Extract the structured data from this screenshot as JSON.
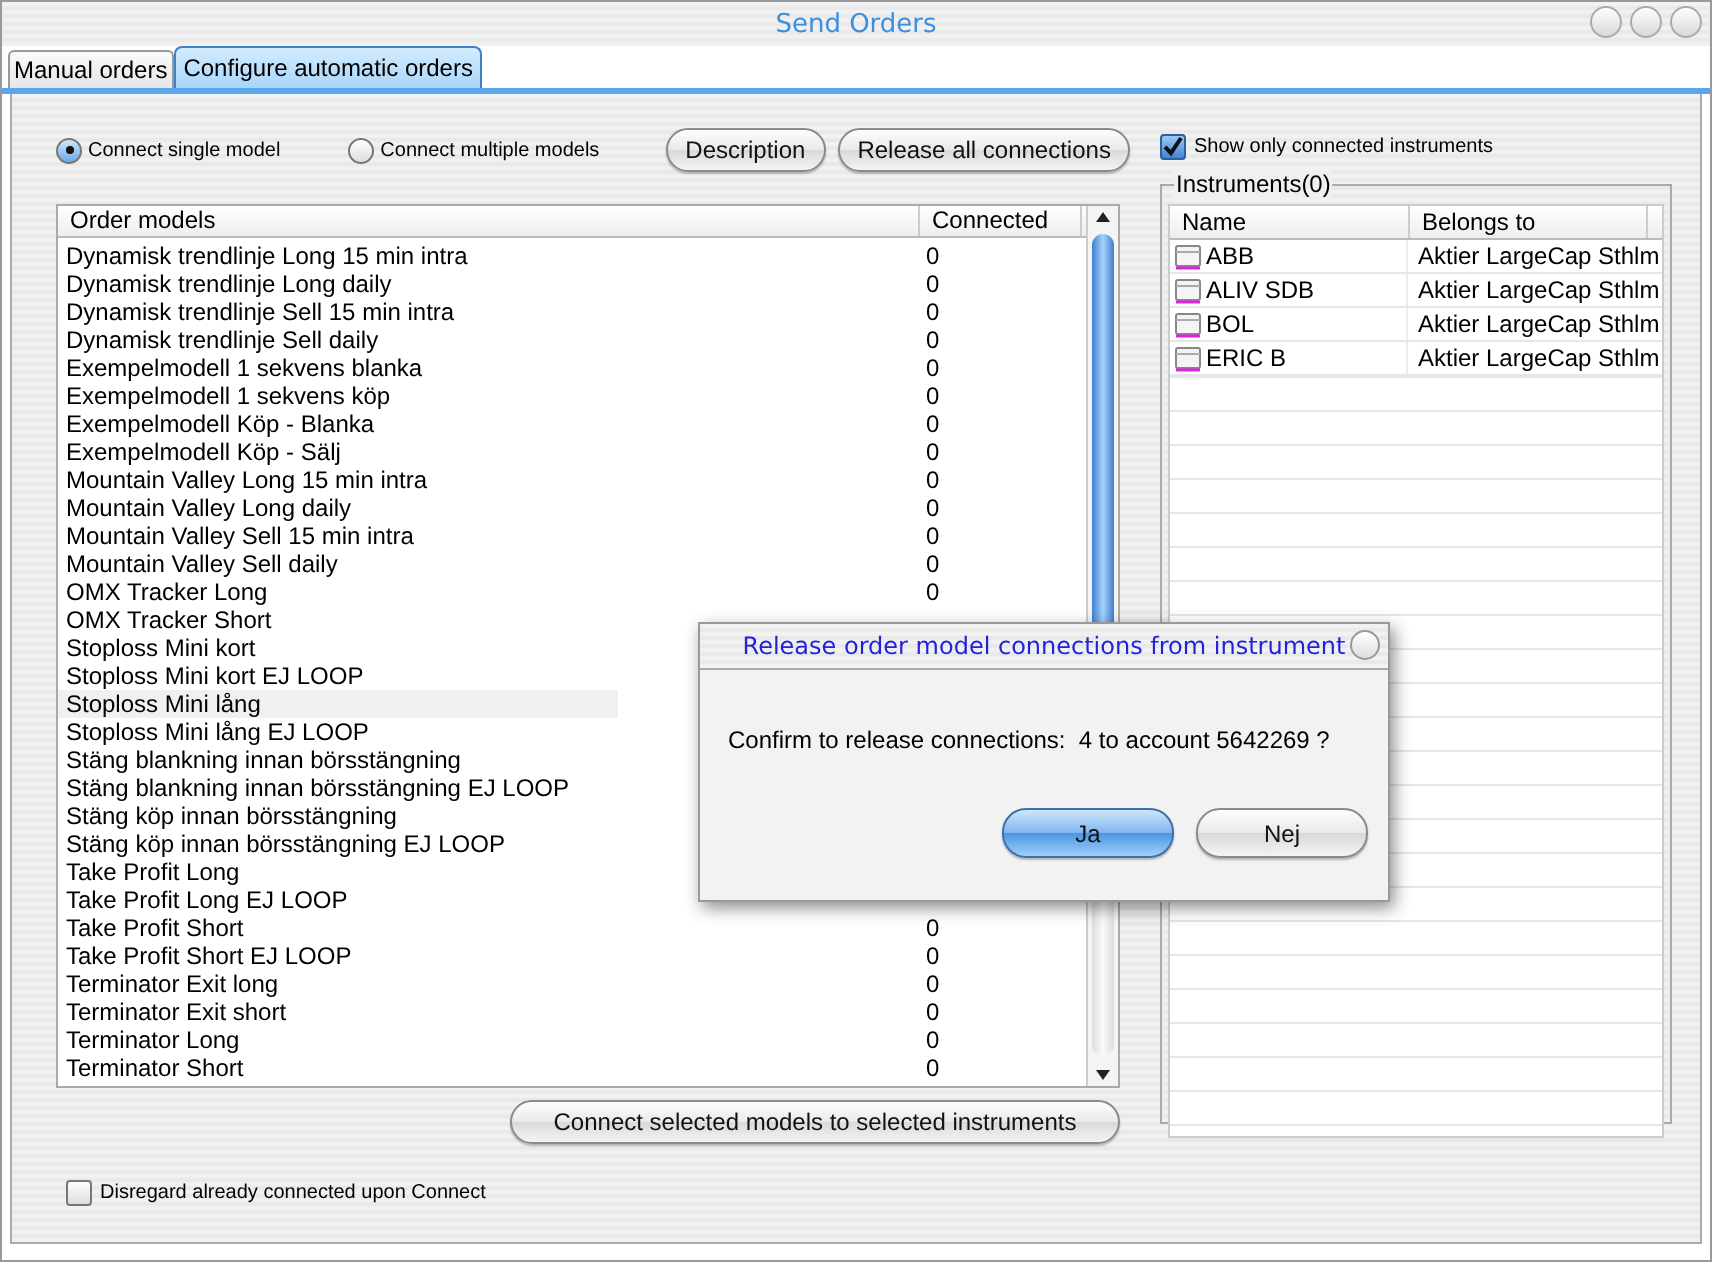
{
  "window": {
    "title": "Send Orders"
  },
  "tabs": [
    {
      "label": "Manual orders",
      "selected": false
    },
    {
      "label": "Configure automatic orders",
      "selected": true
    }
  ],
  "connect_mode": [
    {
      "label": "Connect single model",
      "selected": true
    },
    {
      "label": "Connect multiple models",
      "selected": false
    }
  ],
  "buttons": [
    "Description",
    "Release all connections"
  ],
  "show_only_connected": {
    "label": "Show only connected instruments",
    "checked": true
  },
  "order_models": {
    "columns": [
      "Order models",
      "Connected"
    ],
    "rows": [
      {
        "name": "Dynamisk trendlinje Long 15 min intra",
        "connected": "0",
        "selected": false
      },
      {
        "name": "Dynamisk trendlinje Long daily",
        "connected": "0",
        "selected": false
      },
      {
        "name": "Dynamisk trendlinje Sell 15 min intra",
        "connected": "0",
        "selected": false
      },
      {
        "name": "Dynamisk trendlinje Sell daily",
        "connected": "0",
        "selected": false
      },
      {
        "name": "Exempelmodell 1 sekvens blanka",
        "connected": "0",
        "selected": false
      },
      {
        "name": "Exempelmodell 1 sekvens köp",
        "connected": "0",
        "selected": false
      },
      {
        "name": "Exempelmodell Köp - Blanka",
        "connected": "0",
        "selected": false
      },
      {
        "name": "Exempelmodell Köp - Sälj",
        "connected": "0",
        "selected": false
      },
      {
        "name": "Mountain Valley Long 15 min intra",
        "connected": "0",
        "selected": false
      },
      {
        "name": "Mountain Valley Long daily",
        "connected": "0",
        "selected": false
      },
      {
        "name": "Mountain Valley Sell 15 min intra",
        "connected": "0",
        "selected": false
      },
      {
        "name": "Mountain Valley Sell daily",
        "connected": "0",
        "selected": false
      },
      {
        "name": "OMX Tracker Long",
        "connected": "0",
        "selected": false
      },
      {
        "name": "OMX Tracker Short",
        "selected": false
      },
      {
        "name": "Stoploss Mini kort",
        "selected": false
      },
      {
        "name": "Stoploss Mini kort EJ LOOP",
        "selected": false
      },
      {
        "name": "Stoploss Mini lång",
        "selected": true
      },
      {
        "name": "Stoploss Mini lång EJ LOOP",
        "selected": false
      },
      {
        "name": "Stäng blankning innan börsstängning",
        "selected": false
      },
      {
        "name": "Stäng blankning innan börsstängning EJ LOOP",
        "selected": false
      },
      {
        "name": "Stäng köp innan börsstängning",
        "selected": false
      },
      {
        "name": "Stäng köp innan börsstängning EJ LOOP",
        "selected": false
      },
      {
        "name": "Take Profit Long",
        "selected": false
      },
      {
        "name": "Take Profit Long EJ LOOP",
        "selected": false
      },
      {
        "name": "Take Profit Short",
        "connected": "0",
        "selected": false
      },
      {
        "name": "Take Profit Short EJ LOOP",
        "connected": "0",
        "selected": false
      },
      {
        "name": "Terminator Exit long",
        "connected": "0",
        "selected": false
      },
      {
        "name": "Terminator Exit short",
        "connected": "0",
        "selected": false
      },
      {
        "name": "Terminator Long",
        "connected": "0",
        "selected": false
      },
      {
        "name": "Terminator Short",
        "connected": "0",
        "selected": false
      }
    ]
  },
  "connect_button": "Connect selected models to selected instruments",
  "disregard": {
    "label": "Disregard already connected upon Connect",
    "checked": false
  },
  "instruments": {
    "title": "Instruments(0)",
    "columns": [
      "Name",
      "Belongs to"
    ],
    "rows": [
      {
        "name": "ABB",
        "belongs_to": "Aktier LargeCap Sthlm"
      },
      {
        "name": "ALIV SDB",
        "belongs_to": "Aktier LargeCap Sthlm"
      },
      {
        "name": "BOL",
        "belongs_to": "Aktier LargeCap Sthlm"
      },
      {
        "name": "ERIC B",
        "belongs_to": "Aktier LargeCap Sthlm"
      }
    ]
  },
  "dialog": {
    "title": "Release order model connections from instrument",
    "message": "Confirm to release connections:  4 to account 5642269 ?",
    "buttons": [
      {
        "label": "Ja",
        "default": true
      },
      {
        "label": "Nej",
        "default": false
      }
    ]
  }
}
